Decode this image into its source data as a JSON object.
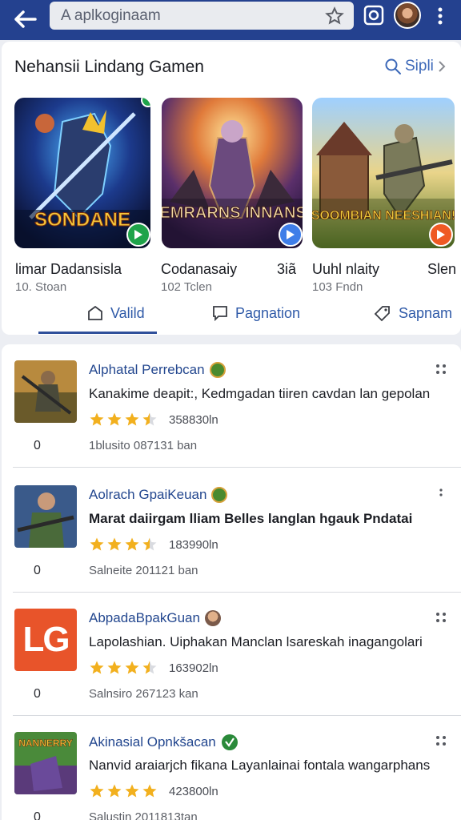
{
  "search": {
    "placeholder": "A aplkoginaam"
  },
  "featured": {
    "title": "Nehansii Lindang Gamen",
    "search_link": "Sipli",
    "games": [
      {
        "art_text": "SONDANE",
        "name": "limar Dadansisla",
        "sub": "10. Stoan"
      },
      {
        "art_text": "MEMRARNS INNANSH",
        "name": "Codanasaiy",
        "extra": "3iã",
        "sub": "102 Tclen"
      },
      {
        "art_text": "SOOMBIAN NEESHIAN!",
        "name": "Uuhl nlaity",
        "extra": "Slen",
        "sub": "103 Fndn"
      }
    ],
    "tabs": [
      "Valild",
      "Pagnation",
      "Sapnam"
    ]
  },
  "apps": [
    {
      "name": "Alphatal Perrebcan",
      "desc": "Kanakime deapit:, Kedmgadan tiiren cavdan lan gepolan",
      "bold": false,
      "rating": 3.5,
      "count": "358830ln",
      "installs": "0",
      "date": "1blusito 087131 ban"
    },
    {
      "name": "Aolrach GpaiKeuan",
      "desc": "Marat daiirgam lliam Belles langlan hgauk Pndatai",
      "bold": true,
      "rating": 3.5,
      "count": "183990ln",
      "installs": "0",
      "date": "Salneite 201121 ban"
    },
    {
      "name": "AbpadaBpakGuan",
      "desc": "Lapolashian. Uiphakan Manclan lsareskah inagangolari",
      "bold": false,
      "rating": 3.5,
      "count": "163902ln",
      "installs": "0",
      "date": "Salnsiro 267123 kan",
      "logo_text": "LG"
    },
    {
      "name": "Akinasial Opnkšacan",
      "desc": "Nanvid araiarjch fikana Layanlainai fontala wangarphans",
      "bold": false,
      "rating": 4.0,
      "count": "423800ln",
      "installs": "0",
      "date": "Salustin 2011813tan",
      "logo_text": "NANNERRY"
    }
  ],
  "colors": {
    "topbar": "#24418f",
    "link": "#2f5aa8",
    "star": "#f2b01e",
    "play_green": "#1fa34a",
    "play_blue": "#3f7ee8",
    "play_orange": "#ef5a24"
  }
}
